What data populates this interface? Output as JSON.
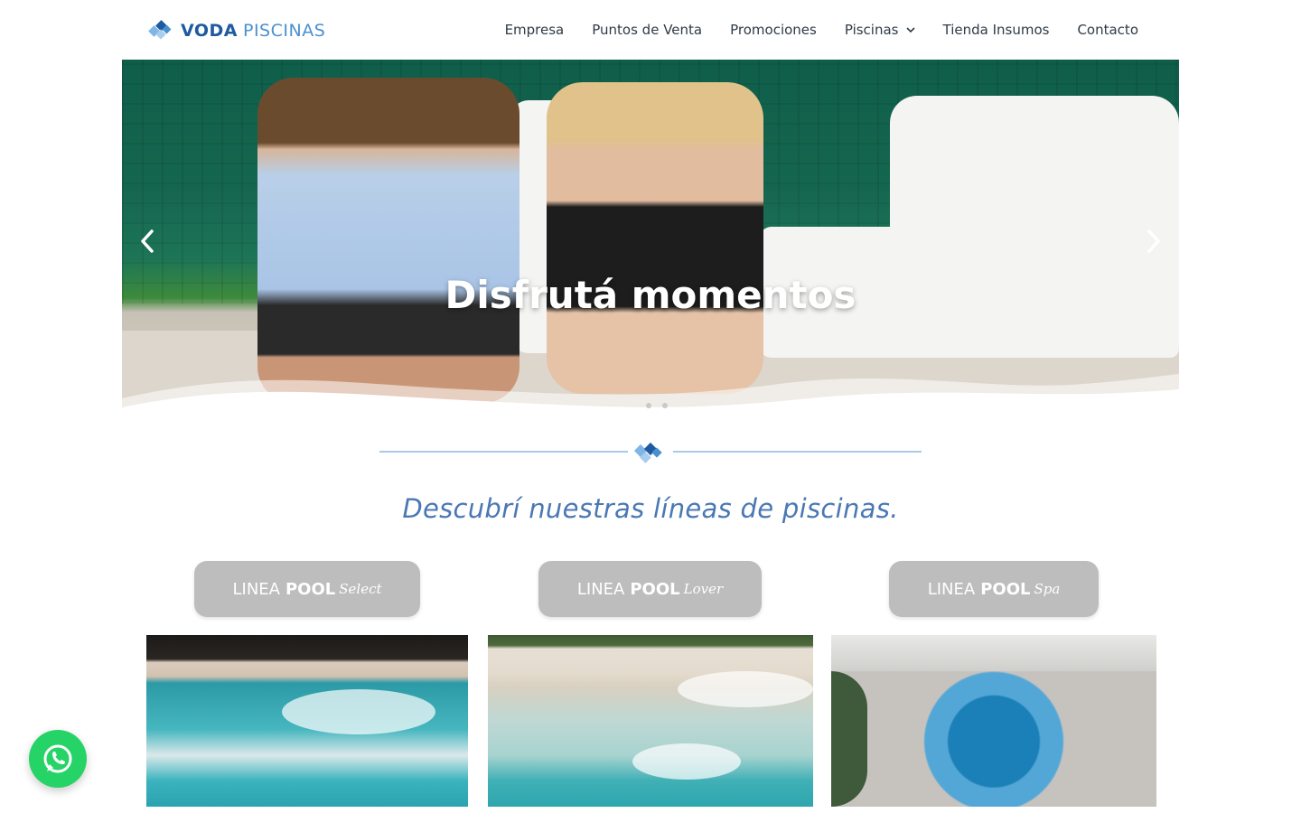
{
  "header": {
    "logo": {
      "brand_bold": "VODA",
      "brand_light": "PISCINAS"
    },
    "nav": [
      {
        "label": "Empresa"
      },
      {
        "label": "Puntos de Venta"
      },
      {
        "label": "Promociones"
      },
      {
        "label": "Piscinas",
        "has_dropdown": true
      },
      {
        "label": "Tienda Insumos"
      },
      {
        "label": "Contacto"
      }
    ]
  },
  "hero": {
    "title": "Disfrutá momentos",
    "slide_count": 2,
    "active_slide": 1
  },
  "section": {
    "title": "Descubrí nuestras líneas de piscinas."
  },
  "lines": [
    {
      "prefix": "LINEA",
      "bold": "POOL",
      "script": "Select"
    },
    {
      "prefix": "LINEA",
      "bold": "POOL",
      "script": "Lover"
    },
    {
      "prefix": "LINEA",
      "bold": "POOL",
      "script": "Spa"
    }
  ],
  "colors": {
    "brand_dark": "#1e5aa0",
    "brand_light": "#4a90d0",
    "section_title": "#4a78b4",
    "button_gray": "#bdbdbd",
    "whatsapp": "#25d366"
  },
  "icons": {
    "logo": "diamond-logo-icon",
    "dropdown": "chevron-down-icon",
    "prev": "chevron-left-icon",
    "next": "chevron-right-icon",
    "whatsapp": "whatsapp-icon"
  }
}
